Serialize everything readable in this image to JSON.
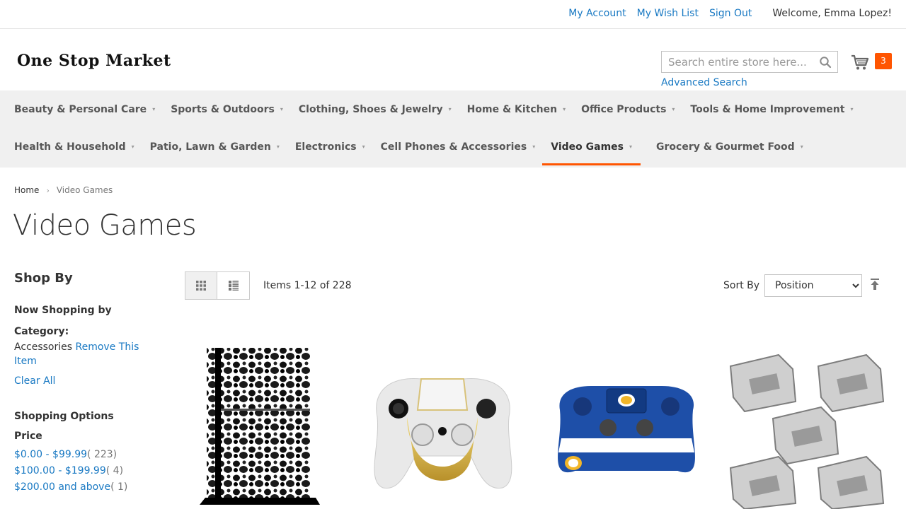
{
  "header": {
    "links": {
      "my_account": "My Account",
      "wish_list": "My Wish List",
      "sign_out": "Sign Out"
    },
    "welcome": "Welcome, Emma Lopez!",
    "logo": "One Stop Market",
    "search": {
      "placeholder": "Search entire store here..."
    },
    "advanced_search": "Advanced Search",
    "cart_count": "3"
  },
  "nav": {
    "row1": [
      "Beauty & Personal Care",
      "Sports & Outdoors",
      "Clothing, Shoes & Jewelry",
      "Home & Kitchen",
      "Office Products",
      "Tools & Home Improvement"
    ],
    "row2": [
      "Health & Household",
      "Patio, Lawn & Garden",
      "Electronics",
      "Cell Phones & Accessories",
      "Video Games",
      "Grocery & Gourmet Food"
    ],
    "active": "Video Games"
  },
  "breadcrumb": {
    "home": "Home",
    "current": "Video Games"
  },
  "page_title": "Video Games",
  "sidebar": {
    "shop_by": "Shop By",
    "now_shopping": "Now Shopping by",
    "filter_label": "Category:",
    "filter_value": "Accessories",
    "remove": "Remove This Item",
    "clear_all": "Clear All",
    "shopping_options": "Shopping Options",
    "price_title": "Price",
    "prices": [
      {
        "label": "$0.00 - $99.99",
        "count": "( 223)"
      },
      {
        "label": "$100.00 - $199.99",
        "count": "( 4)"
      },
      {
        "label": "$200.00 and above",
        "count": "( 1)"
      }
    ]
  },
  "toolbar": {
    "items_count": "Items 1-12 of 228",
    "sort_label": "Sort By",
    "sort_value": "Position"
  },
  "colors": {
    "link": "#1979c3",
    "accent": "#ff5501",
    "nav_bg": "#f0f0f0"
  }
}
